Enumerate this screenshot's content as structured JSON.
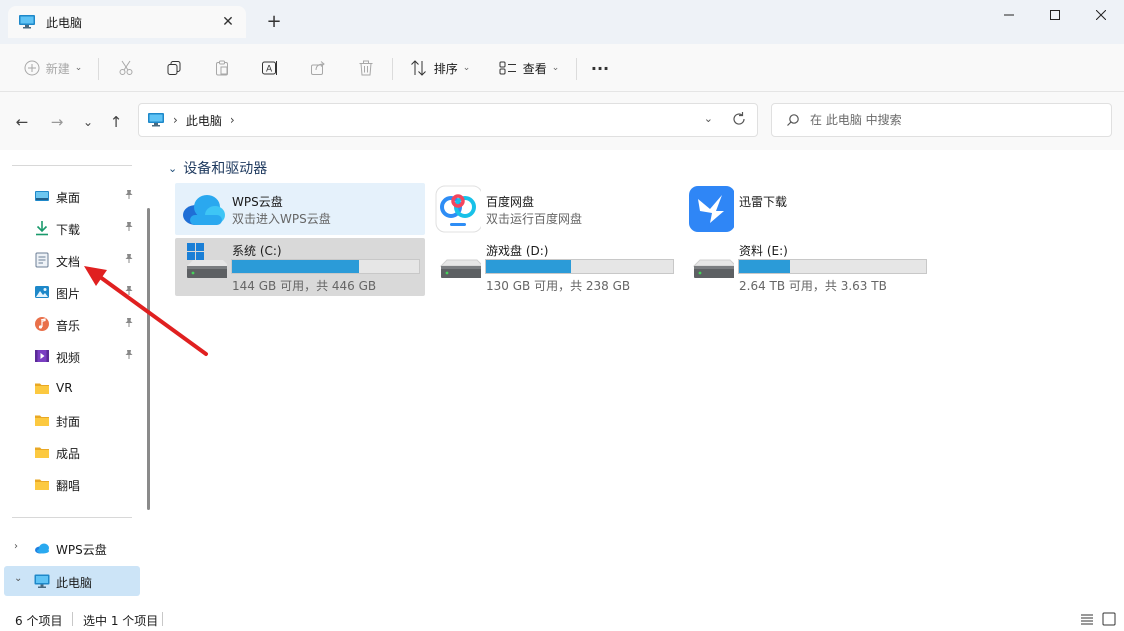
{
  "window": {
    "tab_title": "此电脑",
    "tab_close": "✕",
    "new_tab": "+",
    "minimize": "—",
    "maximize": "☐",
    "close": "✕"
  },
  "toolbar": {
    "new_label": "新建",
    "sort_label": "排序",
    "view_label": "查看",
    "more_label": "···",
    "dropdown_caret": "⌄"
  },
  "nav": {
    "back": "←",
    "forward": "→",
    "recent": "⌄",
    "up": "↑",
    "breadcrumb": [
      "此电脑"
    ],
    "crumb_sep": "›",
    "addr_dropdown": "⌄",
    "search_placeholder": "在 此电脑 中搜索"
  },
  "sidebar": {
    "quick_access": [
      {
        "label": "桌面",
        "icon": "desktop-icon",
        "pinned": true
      },
      {
        "label": "下载",
        "icon": "download-icon",
        "pinned": true
      },
      {
        "label": "文档",
        "icon": "document-icon",
        "pinned": true
      },
      {
        "label": "图片",
        "icon": "pictures-icon",
        "pinned": true
      },
      {
        "label": "音乐",
        "icon": "music-icon",
        "pinned": true
      },
      {
        "label": "视频",
        "icon": "videos-icon",
        "pinned": true
      },
      {
        "label": "VR",
        "icon": "folder-icon",
        "pinned": false
      },
      {
        "label": "封面",
        "icon": "folder-icon",
        "pinned": false
      },
      {
        "label": "成品",
        "icon": "folder-icon",
        "pinned": false
      },
      {
        "label": "翻唱",
        "icon": "folder-icon",
        "pinned": false
      }
    ],
    "roots": [
      {
        "label": "WPS云盘",
        "icon": "wps-cloud-icon",
        "expander": "›"
      },
      {
        "label": "此电脑",
        "icon": "this-pc-icon",
        "expander": "⌄"
      }
    ],
    "pin_glyph": "📌"
  },
  "main": {
    "group_title": "设备和驱动器",
    "group_chevron": "⌄",
    "apps": [
      {
        "name": "WPS云盘",
        "subtitle": "双击进入WPS云盘"
      },
      {
        "name": "百度网盘",
        "subtitle": "双击运行百度网盘"
      },
      {
        "name": "迅雷下载",
        "subtitle": ""
      }
    ],
    "drives": [
      {
        "name": "系统 (C:)",
        "usage": "144 GB 可用，共 446 GB",
        "used_fraction": 0.677
      },
      {
        "name": "游戏盘 (D:)",
        "usage": "130 GB 可用，共 238 GB",
        "used_fraction": 0.454
      },
      {
        "name": "资料 (E:)",
        "usage": "2.64 TB 可用，共 3.63 TB",
        "used_fraction": 0.273
      }
    ]
  },
  "status": {
    "item_count": "6 个项目",
    "selection": "选中 1 个项目"
  },
  "colors": {
    "accent": "#2b9bd8",
    "selection": "#cce4f7",
    "annotation_arrow": "#e02020"
  }
}
